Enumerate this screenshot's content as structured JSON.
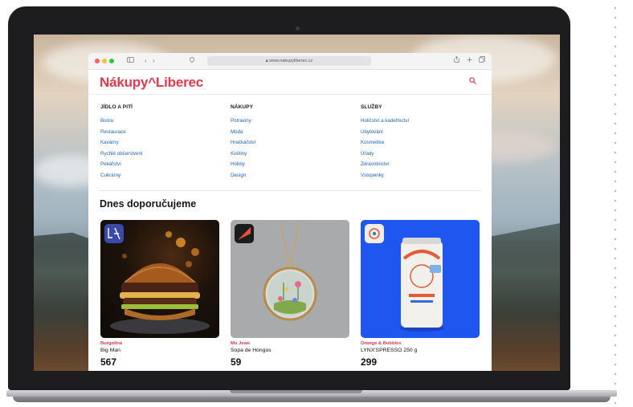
{
  "browser": {
    "url": "www.nakupyliberec.cz",
    "nav_back": "‹",
    "nav_forward": "›",
    "colors": {
      "close": "#ff5f57",
      "minimize": "#febc2e",
      "zoom": "#28c840"
    }
  },
  "site": {
    "logo": "Nákupy^Liberec",
    "brand_color": "#e5394b",
    "columns": [
      {
        "heading": "JÍDLO A PITÍ",
        "items": [
          "Bistra",
          "Restaurace",
          "Kavárny",
          "Rychlé občerstvení",
          "Pekářství",
          "Cukrárny"
        ]
      },
      {
        "heading": "NÁKUPY",
        "items": [
          "Potraviny",
          "Móda",
          "Hračkářství",
          "Květiny",
          "Hobby",
          "Design"
        ]
      },
      {
        "heading": "SLUŽBY",
        "items": [
          "Holičství a kadeřnictví",
          "Ubytování",
          "Kosmetika",
          "Úřady",
          "Zdravotnictví",
          "Vstupenky"
        ]
      }
    ],
    "section_title": "Dnes doporučujeme",
    "products": [
      {
        "shop": "Burgolina",
        "name": "Big Man",
        "price": "567"
      },
      {
        "shop": "Mu Jewe",
        "name": "Sopa de Hongos",
        "price": "59"
      },
      {
        "shop": "Orange & Bubbles",
        "name": "LYNX'SPRESSO 250 g",
        "price": "299"
      }
    ]
  }
}
